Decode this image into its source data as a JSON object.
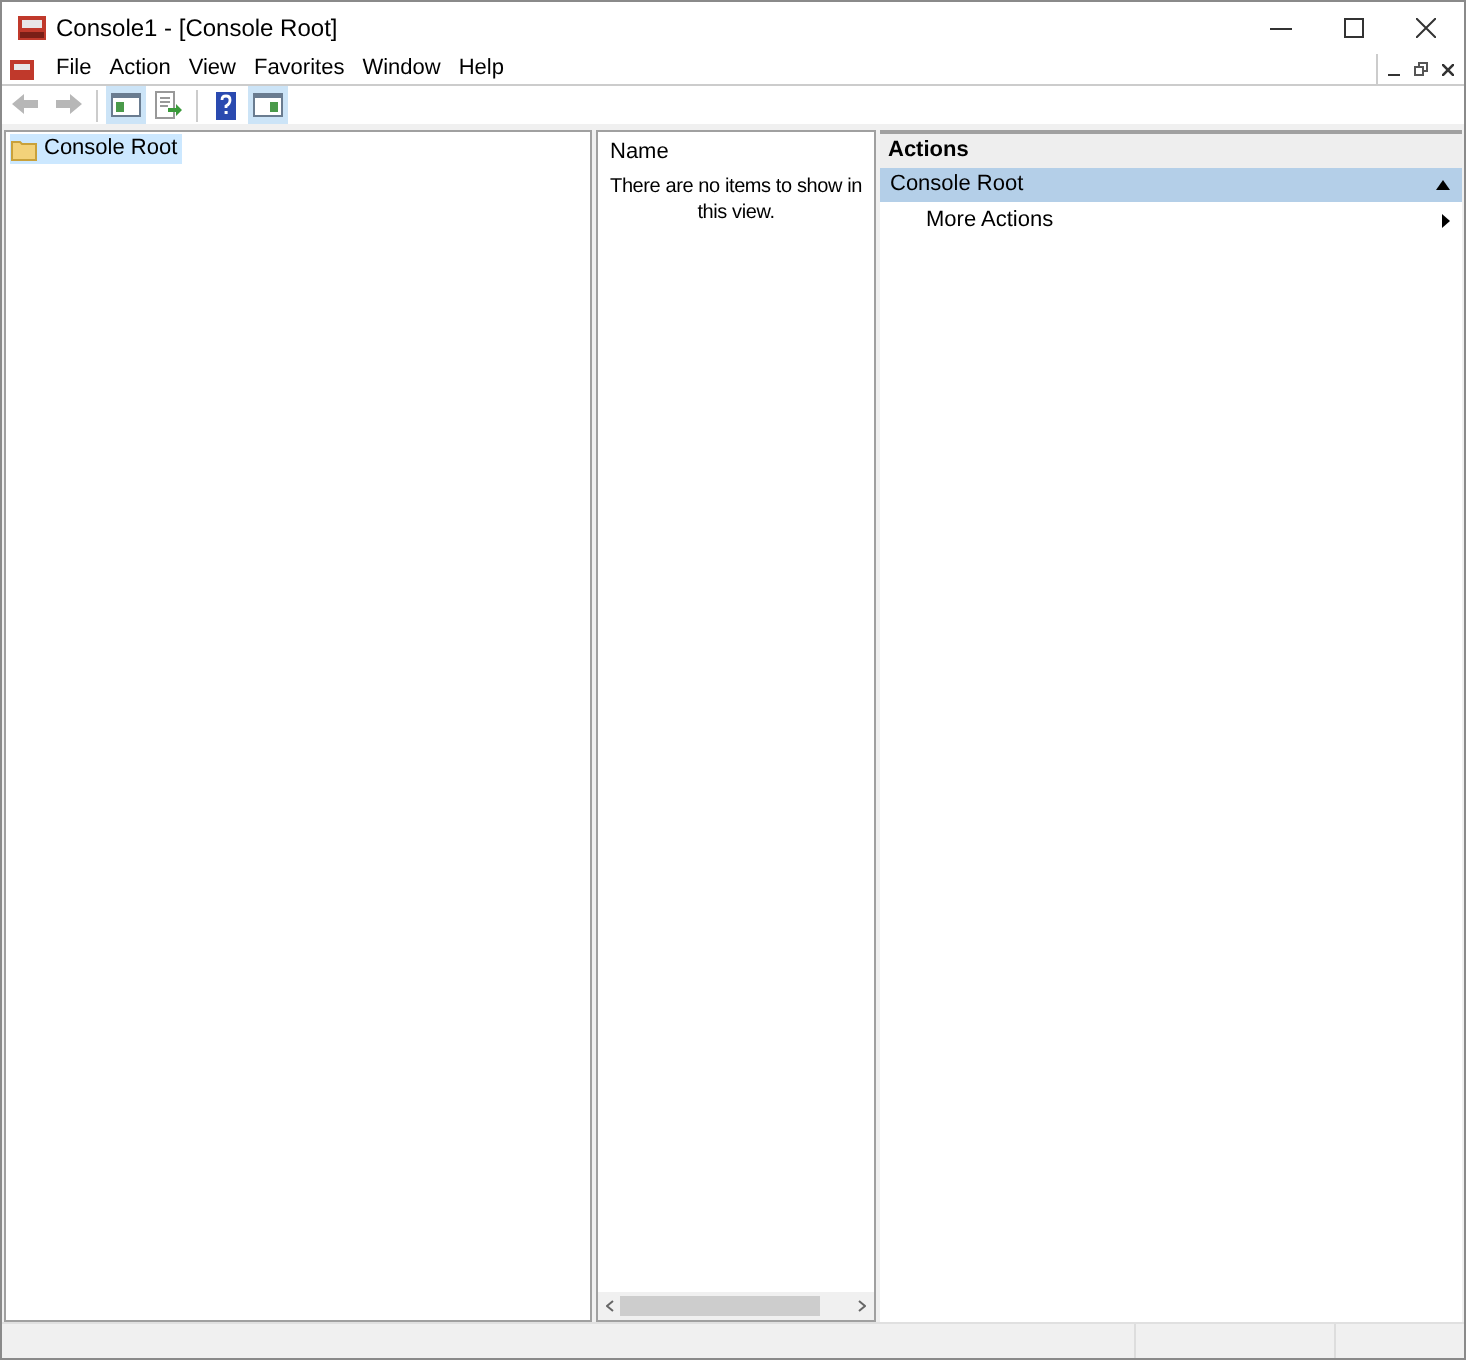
{
  "window": {
    "title": "Console1 - [Console Root]"
  },
  "menu": [
    "File",
    "Action",
    "View",
    "Favorites",
    "Window",
    "Help"
  ],
  "toolbar": [
    {
      "kind": "back",
      "pressed": false,
      "disabled": true
    },
    {
      "kind": "forward",
      "pressed": false,
      "disabled": true
    },
    {
      "kind": "tree",
      "pressed": true,
      "disabled": false
    },
    {
      "kind": "export",
      "pressed": false,
      "disabled": false
    },
    {
      "kind": "help",
      "pressed": false,
      "disabled": false
    },
    {
      "kind": "actionpane",
      "pressed": true,
      "disabled": false
    }
  ],
  "tree": [
    {
      "label": "Console Root",
      "selected": true
    }
  ],
  "list": {
    "columns": [
      "Name"
    ],
    "empty_message": "There are no items to show in this view."
  },
  "actions": {
    "title": "Actions",
    "sections": [
      {
        "label": "Console Root",
        "expanded": true,
        "items": [
          "More Actions"
        ]
      }
    ]
  }
}
